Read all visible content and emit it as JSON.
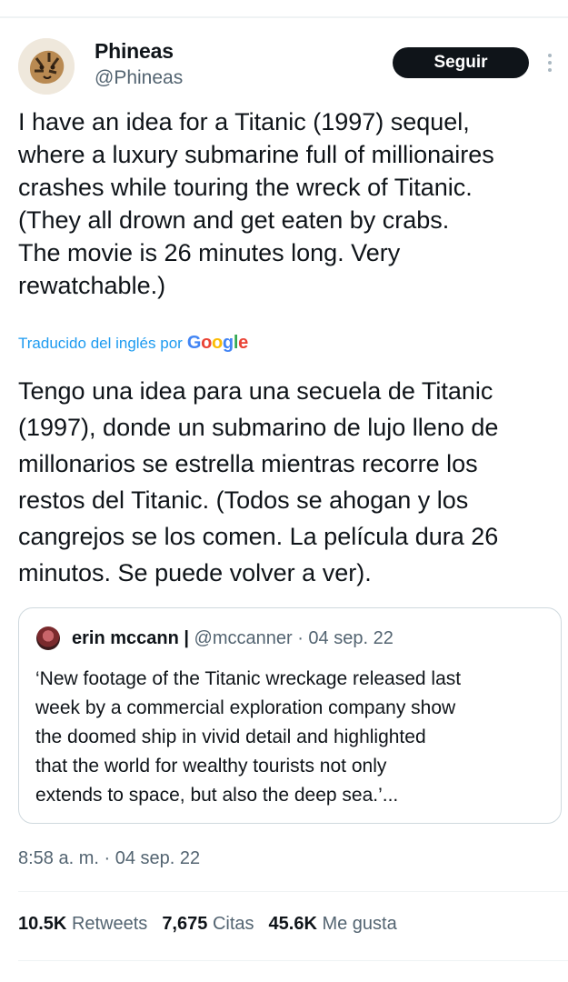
{
  "author": {
    "name": "Phineas",
    "handle": "@Phineas"
  },
  "follow_label": "Seguir",
  "more_icon": "more-vertical-icon",
  "tweet_text": "I have an idea for a Titanic (1997) sequel,\nwhere a luxury submarine full of millionaires\ncrashes while touring the wreck of Titanic.\n(They all drown and get eaten by crabs.\nThe movie is 26 minutes long. Very\nrewatchable.)",
  "translation": {
    "label": "Traducido del inglés por",
    "provider": "Google",
    "text": "Tengo una idea para una secuela de Titanic\n(1997), donde un submarino de lujo lleno de\nmillonarios se estrella mientras recorre los\nrestos del Titanic. (Todos se ahogan y los\ncangrejos se los comen. La película dura 26\nminutos. Se puede volver a ver)."
  },
  "quoted_tweet": {
    "name": "erin mccann |",
    "meta": "@mccanner · 04 sep. 22",
    "text": "‘New footage of the Titanic wreckage released last\nweek by a commercial exploration company show\nthe doomed ship in vivid detail and highlighted\nthat the world for wealthy tourists not only\nextends to space, but also the deep sea.’..."
  },
  "timestamp": "8:58 a. m. · 04 sep. 22",
  "stats": {
    "retweets_count": "10.5K",
    "retweets_label": "Retweets",
    "quotes_count": "7,675",
    "quotes_label": "Citas",
    "likes_count": "45.6K",
    "likes_label": "Me gusta"
  },
  "colors": {
    "link": "#1d9bf0",
    "button_bg": "#0f1419",
    "secondary_text": "#536471"
  }
}
